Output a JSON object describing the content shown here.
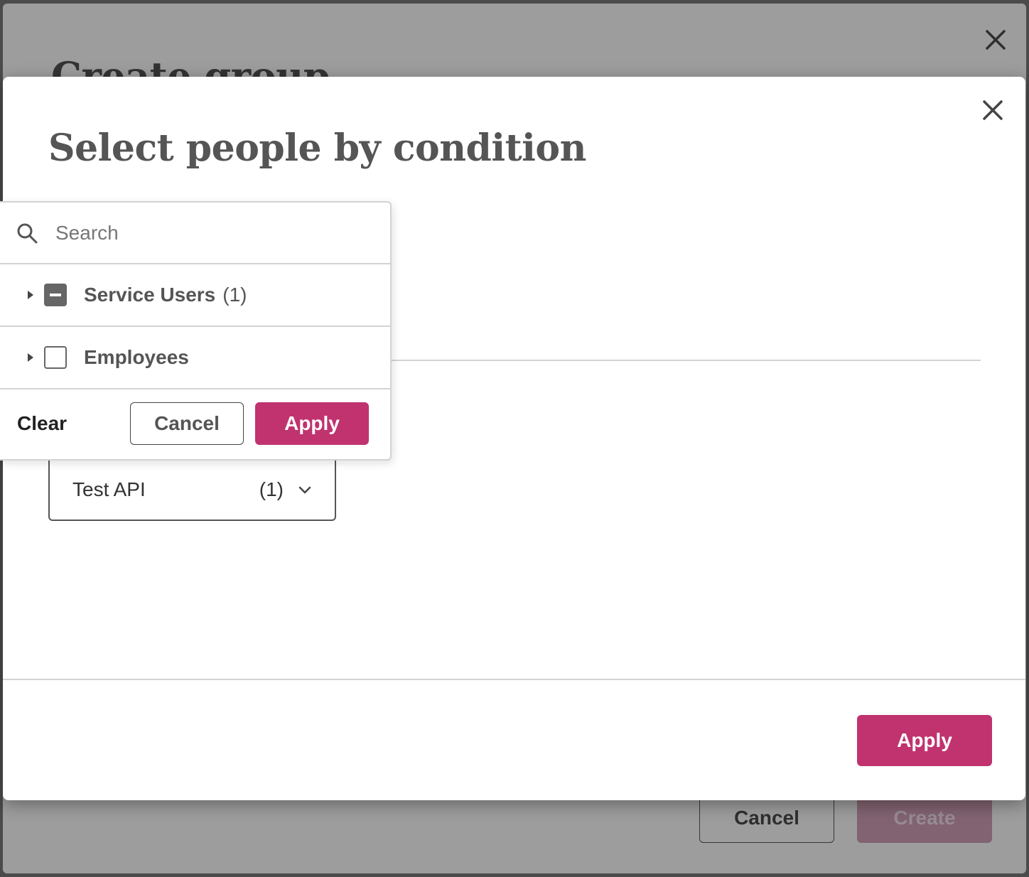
{
  "background_modal": {
    "title": "Create group",
    "close_icon": "close-icon",
    "cancel_label": "Cancel",
    "create_label": "Create"
  },
  "modal": {
    "title": "Select people by condition",
    "close_icon": "close-icon",
    "apply_label": "Apply",
    "accent_color": "#c0336f"
  },
  "condition_select": {
    "value": "Test API",
    "count": "(1)",
    "icon": "chevron-down-icon"
  },
  "popover": {
    "search": {
      "placeholder": "Search",
      "value": "",
      "icon": "search-icon"
    },
    "items": [
      {
        "label": "Service Users",
        "count": "(1)",
        "state": "indeterminate",
        "icon": "caret-right-icon"
      },
      {
        "label": "Employees",
        "count": "",
        "state": "unchecked",
        "icon": "caret-right-icon"
      }
    ],
    "clear_label": "Clear",
    "cancel_label": "Cancel",
    "apply_label": "Apply"
  }
}
